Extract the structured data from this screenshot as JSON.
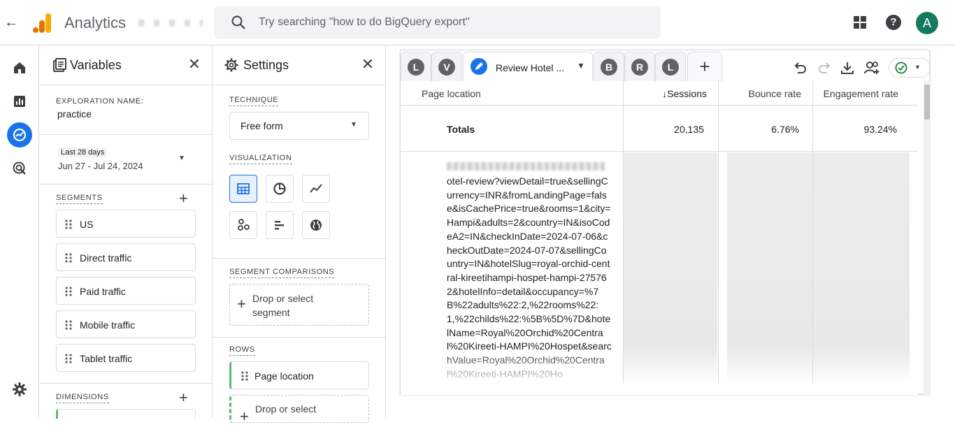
{
  "app": {
    "title": "Analytics",
    "search_placeholder": "Try searching \"how to do BigQuery export\"",
    "avatar_letter": "A",
    "colors": {
      "brand_orange": "#f9ab00",
      "brand_dark": "#e37400",
      "accent_blue": "#1a73e8",
      "avatar_green": "#137a5e",
      "row_green": "#5bb974"
    }
  },
  "left_nav": {
    "icons": [
      "home-icon",
      "reports-icon",
      "explore-icon",
      "advertising-icon",
      "admin-gear-icon"
    ],
    "active": "explore-icon"
  },
  "variables": {
    "title": "Variables",
    "exploration_name_label": "EXPLORATION NAME:",
    "exploration_name_value": "practice",
    "date_chip": "Last 28 days",
    "date_range": "Jun 27 - Jul 24, 2024",
    "segments_label": "SEGMENTS",
    "segments": [
      "US",
      "Direct traffic",
      "Paid traffic",
      "Mobile traffic",
      "Tablet traffic"
    ],
    "dimensions_label": "DIMENSIONS"
  },
  "settings": {
    "title": "Settings",
    "technique_label": "TECHNIQUE",
    "technique_value": "Free form",
    "visualization_label": "VISUALIZATION",
    "segment_comparisons_label": "SEGMENT COMPARISONS",
    "segment_drop_text": "Drop or select segment",
    "rows_label": "ROWS",
    "row_item": "Page location",
    "rows_drop_text": "Drop or select"
  },
  "tabs": {
    "chips": [
      "L",
      "V",
      "B",
      "R",
      "L"
    ],
    "active_label": "Review Hotel ...",
    "add": "+"
  },
  "table": {
    "columns": [
      "Page location",
      "↓Sessions",
      "Bounce rate",
      "Engagement rate"
    ],
    "totals": {
      "label": "Totals",
      "sessions": "20,135",
      "bounce_rate": "6.76%",
      "engagement_rate": "93.24%"
    },
    "row_url": "otel-review?viewDetail=true&sellingCurrency=INR&fromLandingPage=false&isCachePrice=true&rooms=1&city=Hampi&adults=2&country=IN&isoCodeA2=IN&checkInDate=2024-07-06&checkOutDate=2024-07-07&sellingCountry=IN&hotelSlug=royal-orchid-central-kireetihampi-hospet-hampi-275762&hotelInfo=detail&occupancy=%7B%22adults%22:2,%22rooms%22:1,%22childs%22:%5B%5D%7D&hotelName=Royal%20Orchid%20Central%20Kireeti-HAMPI%20Hospet&searchValue=Royal%20Orchid%20Central%20Kireeti-HAMPI%20Ho"
  }
}
